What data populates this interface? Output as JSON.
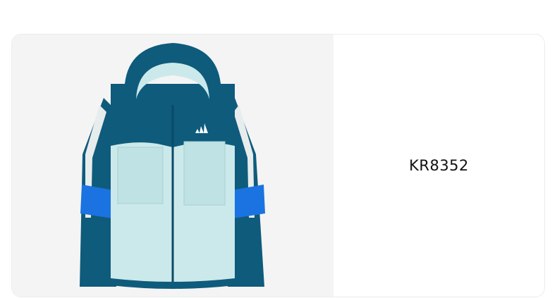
{
  "product": {
    "code": "KR8352",
    "image": {
      "icon": "hooded-jacket-image",
      "brand_mark": "adidas-performance-logo",
      "colors": {
        "dark_teal": "#0e5b7c",
        "light_mint": "#cbe9ea",
        "accent_blue": "#1a73e0",
        "background": "#f4f4f4"
      }
    }
  }
}
